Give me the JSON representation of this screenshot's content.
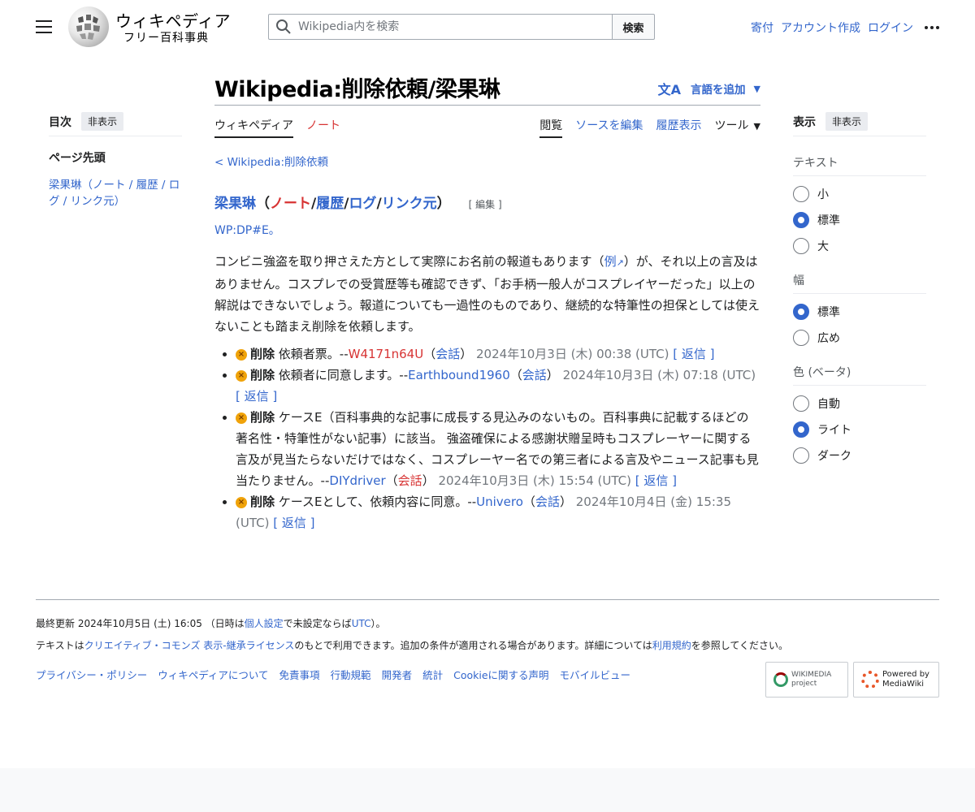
{
  "header": {
    "logo_title": "ウィキペディア",
    "logo_subtitle": "フリー百科事典",
    "search_placeholder": "Wikipedia内を検索",
    "search_button": "検索",
    "user_links": [
      "寄付",
      "アカウント作成",
      "ログイン"
    ]
  },
  "toc": {
    "title": "目次",
    "hide": "非表示",
    "top": "ページ先頭",
    "item": "梁果琳（ノート / 履歴 / ログ / リンク元）"
  },
  "page": {
    "title": "Wikipedia:削除依頼/梁果琳",
    "add_language": "言語を追加",
    "tabs_left": [
      "ウィキペディア",
      "ノート"
    ],
    "tabs_right": [
      "閲覧",
      "ソースを編集",
      "履歴表示",
      "ツール"
    ],
    "breadcrumb": "< Wikipedia:削除依頼",
    "section": {
      "name": "梁果琳",
      "open": "（",
      "note": "ノート",
      "sep1": " / ",
      "history": "履歴",
      "sep2": " / ",
      "log": "ログ",
      "sep3": " / ",
      "links": "リンク元",
      "close": "）",
      "edit": "[ 編集 ]"
    },
    "shortcut": "WP:DP#E。",
    "para_a": "コンビニ強盗を取り押さえた方として実際にお名前の報道もあります（",
    "para_link": "例",
    "para_b": "）が、それ以上の言及はありません。コスプレでの受賞歴等も確認できず、「お手柄一般人がコスプレイヤーだった」以上の解説はできないでしょう。報道についても一過性のものであり、継続的な特筆性の担保としては使えないことも踏まえ削除を依頼します。",
    "votes": [
      {
        "label": "削除",
        "text": " 依頼者票。--",
        "user": "W4171n64U",
        "talk": "会話",
        "time": " 2024年10月3日 (木) 00:38 (UTC)",
        "reply": "[ 返信 ]"
      },
      {
        "label": "削除",
        "text": " 依頼者に同意します。--",
        "user": "Earthbound1960",
        "talk": "会話",
        "time": " 2024年10月3日 (木) 07:18 (UTC)",
        "reply": "[ 返信 ]"
      },
      {
        "label": "削除",
        "text": " ケースE（百科事典的な記事に成長する見込みのないもの。百科事典に記載するほどの著名性・特筆性がない記事）に該当。 強盗確保による感謝状贈呈時もコスプレーヤーに関する言及が見当たらないだけではなく、コスプレーヤー名での第三者による言及やニュース記事も見当たりません。--",
        "user": "DIYdriver",
        "talk": "会話",
        "time": " 2024年10月3日 (木) 15:54 (UTC)",
        "reply": "[ 返信 ]"
      },
      {
        "label": "削除",
        "text": " ケースEとして、依頼内容に同意。--",
        "user": "Univero",
        "talk": "会話",
        "time": " 2024年10月4日 (金) 15:35 (UTC)",
        "reply": "[ 返信 ]"
      }
    ]
  },
  "appearance": {
    "title": "表示",
    "hide": "非表示",
    "groups": [
      {
        "label": "テキスト",
        "options": [
          "小",
          "標準",
          "大"
        ],
        "selected": 1
      },
      {
        "label": "幅",
        "options": [
          "標準",
          "広め"
        ],
        "selected": 0
      },
      {
        "label": "色 (ベータ)",
        "options": [
          "自動",
          "ライト",
          "ダーク"
        ],
        "selected": 1
      }
    ]
  },
  "footer": {
    "last_a": "最終更新 2024年10月5日 (土) 16:05 （日時は",
    "last_link1": "個人設定",
    "last_b": "で未設定ならば",
    "last_link2": "UTC",
    "last_c": "）。",
    "lic_a": "テキストは",
    "lic_link": "クリエイティブ・コモンズ 表示-継承ライセンス",
    "lic_b": "のもとで利用できます。追加の条件が適用される場合があります。詳細については",
    "lic_link2": "利用規約",
    "lic_c": "を参照してください。",
    "links": [
      "プライバシー・ポリシー",
      "ウィキペディアについて",
      "免責事項",
      "行動規範",
      "開発者",
      "統計",
      "Cookieに関する声明",
      "モバイルビュー"
    ],
    "badge1": "WIKIMEDIA project",
    "badge2": "Powered by MediaWiki"
  }
}
